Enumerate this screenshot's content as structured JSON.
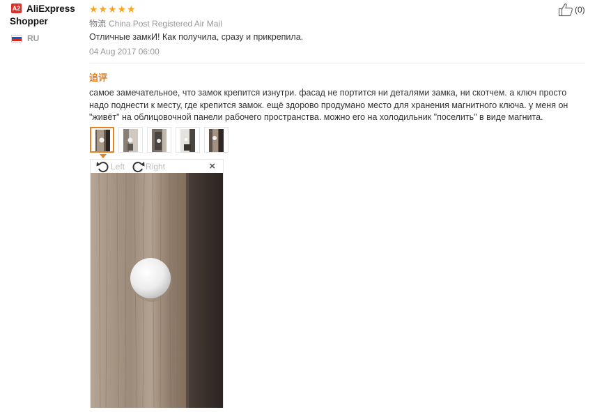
{
  "user": {
    "badge": "A2",
    "name_line1": "AliExpress",
    "name_line2": "Shopper",
    "country": "RU",
    "flag_colors": [
      "#ffffff",
      "#1c57c9",
      "#d52b1e"
    ]
  },
  "review": {
    "rating": 5,
    "stars": "★★★★★",
    "logistics_label": "物流",
    "logistics_value": "China Post Registered Air Mail",
    "text": "Отличные замкИ! Как получила, сразу и прикрепила.",
    "date": "04 Aug 2017 06:00"
  },
  "helpful": {
    "icon": "thumbs-up-icon",
    "count": "(0)"
  },
  "followup": {
    "title": "追评",
    "text": "самое замечательное, что замок крепится изнутри. фасад не портится ни деталями замка, ни скотчем. а ключ просто надо поднести к месту, где крепится замок. ещё здорово продумано место для хранения магнитного ключа. у меня он \"живёт\" на облицовочной панели рабочего пространства. можно его на холодильник \"поселить\" в виде магнита."
  },
  "viewer": {
    "rotate_left": "Left",
    "rotate_right": "Right",
    "close": "×",
    "thumbnail_count": 5,
    "active_thumbnail": 1
  },
  "colors": {
    "accent_orange": "#e8801e",
    "star": "#f5a623",
    "followup_title": "#e87b1c",
    "badge": "#d9312b"
  }
}
